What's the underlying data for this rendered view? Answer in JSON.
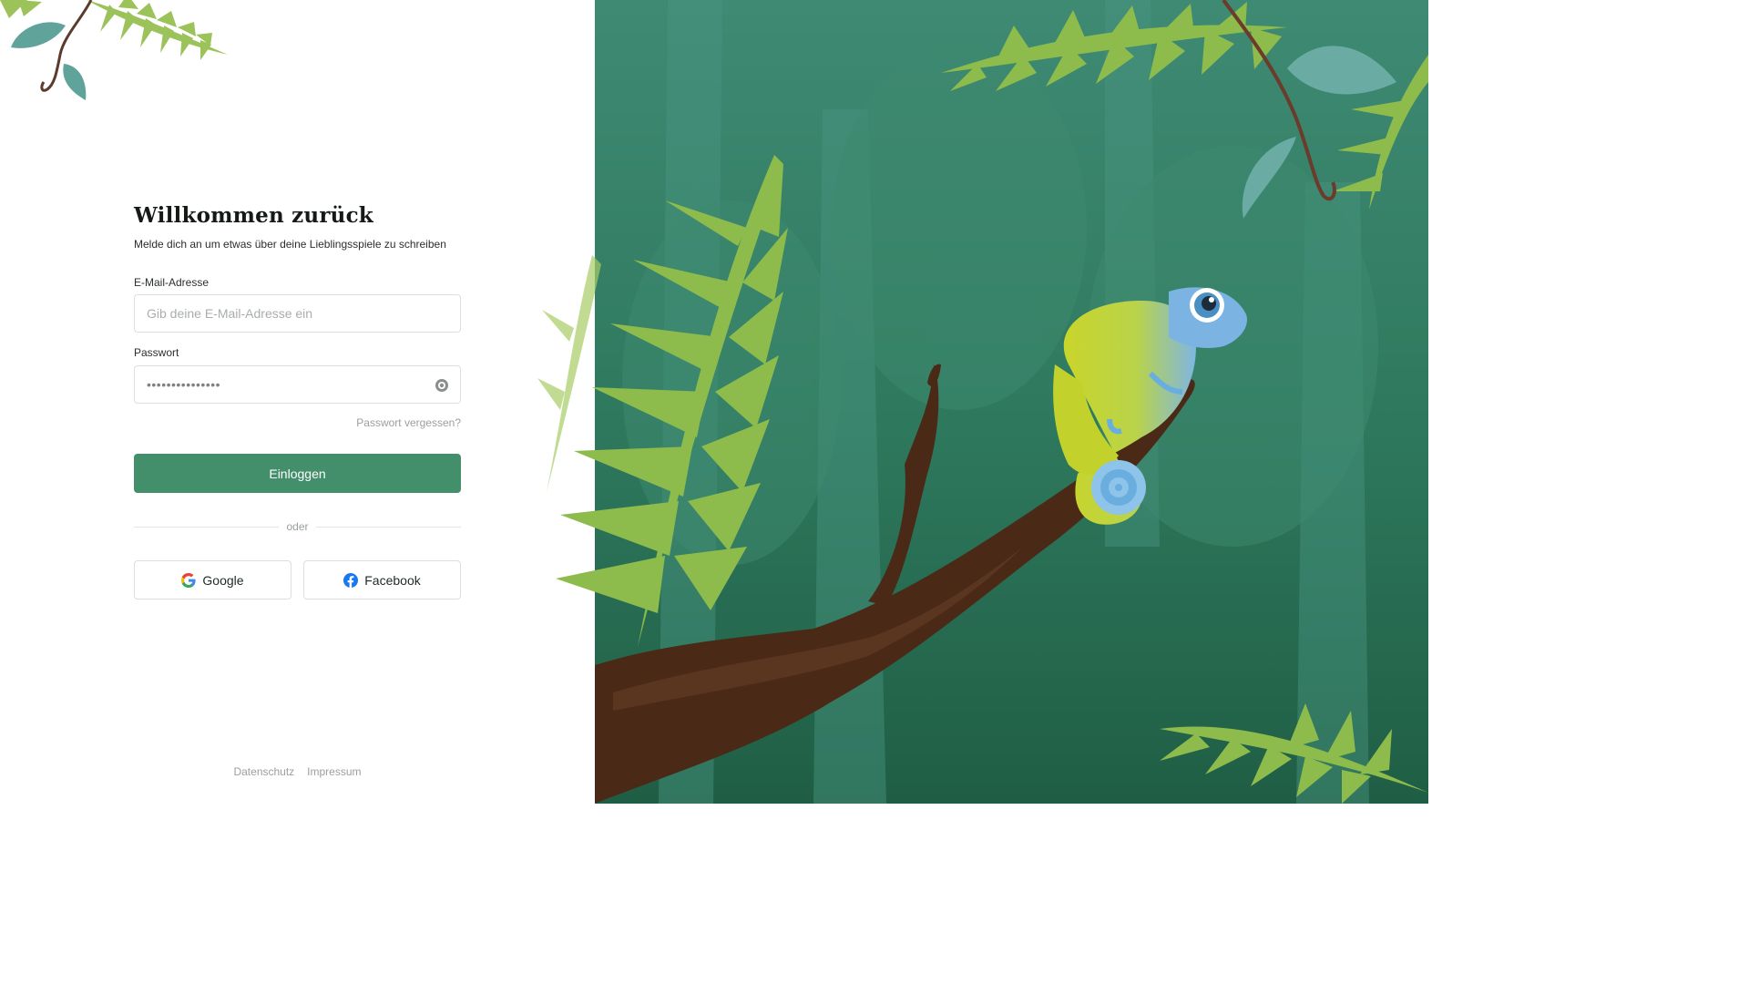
{
  "login": {
    "title": "Willkommen zurück",
    "subtitle": "Melde dich an um etwas über deine Lieblingsspiele zu schreiben",
    "email_label": "E-Mail-Adresse",
    "email_placeholder": "Gib deine E-Mail-Adresse ein",
    "email_value": "",
    "password_label": "Passwort",
    "password_value": "•••••••••••••••",
    "forgot_password": "Passwort vergessen?",
    "login_button": "Einloggen",
    "divider_text": "oder",
    "google_button": "Google",
    "facebook_button": "Facebook"
  },
  "footer": {
    "privacy": "Datenschutz",
    "imprint": "Impressum"
  },
  "icons": {
    "password_toggle": "eye-icon",
    "google": "google-icon",
    "facebook": "facebook-icon"
  },
  "colors": {
    "accent": "#448f6b",
    "background_jungle": "#2f7a5d",
    "foliage": "#8dbb4c",
    "chameleon_body": "#c6d22a",
    "chameleon_head": "#7bb4e3",
    "branch": "#4a2a17"
  }
}
